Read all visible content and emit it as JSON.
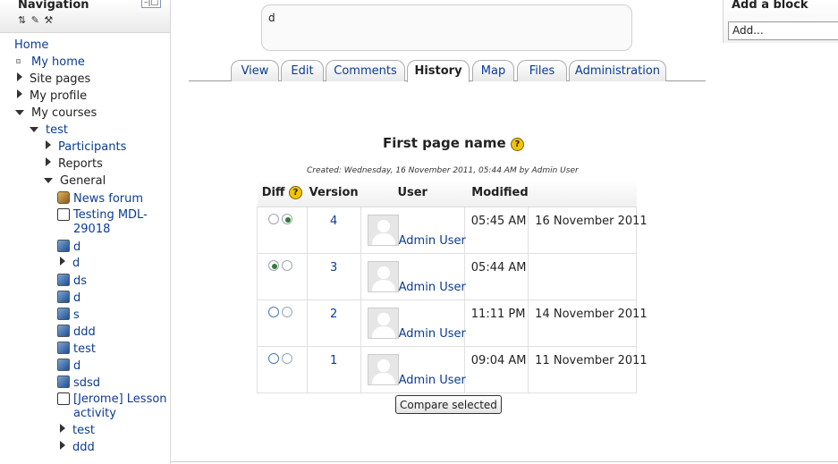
{
  "nav": {
    "title": "Navigation",
    "home": "Home",
    "my_home": "My home",
    "site_pages": "Site pages",
    "my_profile": "My profile",
    "my_courses": "My courses",
    "course": "test",
    "participants": "Participants",
    "reports": "Reports",
    "general": "General",
    "items": [
      {
        "label": "News forum",
        "icon": "forum-icon"
      },
      {
        "label": "Testing MDL-29018",
        "icon": "lesson-icon"
      },
      {
        "label": "d",
        "icon": "page-icon"
      },
      {
        "label": "d",
        "icon": "expand"
      },
      {
        "label": "ds",
        "icon": "page-icon"
      },
      {
        "label": "d",
        "icon": "page-icon"
      },
      {
        "label": "s",
        "icon": "page-icon"
      },
      {
        "label": "ddd",
        "icon": "page-icon"
      },
      {
        "label": "test",
        "icon": "page-icon"
      },
      {
        "label": "d",
        "icon": "page-icon"
      },
      {
        "label": "sdsd",
        "icon": "page-icon"
      },
      {
        "label": "[Jerome] Lesson activity",
        "icon": "lesson-icon"
      },
      {
        "label": "test",
        "icon": "expand"
      },
      {
        "label": "ddd",
        "icon": "expand"
      }
    ]
  },
  "content": {
    "textbox_value": "d",
    "tabs": [
      "View",
      "Edit",
      "Comments",
      "History",
      "Map",
      "Files",
      "Administration"
    ],
    "active_tab": "History",
    "heading": "First page name",
    "created": "Created: Wednesday, 16 November 2011, 05:44 AM by Admin User",
    "columns": {
      "diff": "Diff",
      "version": "Version",
      "user": "User",
      "modified": "Modified"
    },
    "rows": [
      {
        "version": "4",
        "user": "Admin User",
        "time": "05:45 AM",
        "date": "16 November 2011"
      },
      {
        "version": "3",
        "user": "Admin User",
        "time": "05:44 AM",
        "date": ""
      },
      {
        "version": "2",
        "user": "Admin User",
        "time": "11:11 PM",
        "date": "14 November 2011"
      },
      {
        "version": "1",
        "user": "Admin User",
        "time": "09:04 AM",
        "date": "11 November 2011"
      }
    ],
    "compare_button": "Compare selected"
  },
  "addblock": {
    "title": "Add a block",
    "select_value": "Add..."
  }
}
